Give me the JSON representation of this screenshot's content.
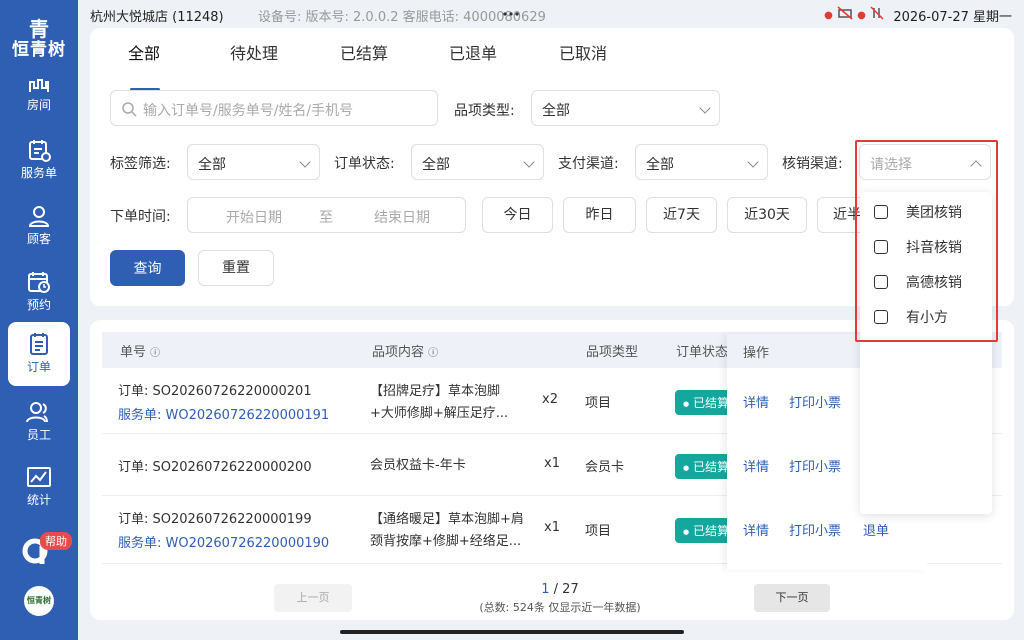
{
  "status_bar": {
    "store": "杭州大悦城店 (11248)",
    "device": "设备号: 版本号: 2.0.0.2  客服电话: 4000080629",
    "datetime": "2026-07-27 星期一"
  },
  "sidebar": {
    "logo_mark": "青",
    "brand": "恒青树",
    "items": [
      {
        "label": "房间",
        "icon": "room-icon"
      },
      {
        "label": "服务单",
        "icon": "service-order-icon"
      },
      {
        "label": "顾客",
        "icon": "customer-icon"
      },
      {
        "label": "预约",
        "icon": "calendar-icon"
      },
      {
        "label": "订单",
        "icon": "order-icon"
      },
      {
        "label": "员工",
        "icon": "staff-icon"
      },
      {
        "label": "统计",
        "icon": "stats-icon"
      }
    ],
    "help_label": "帮助",
    "bottom_logo": "恒青树"
  },
  "tabs": [
    "全部",
    "待处理",
    "已结算",
    "已退单",
    "已取消"
  ],
  "filters": {
    "search_placeholder": "输入订单号/服务单号/姓名/手机号",
    "item_type_label": "品项类型:",
    "item_type_value": "全部",
    "tag_label": "标签筛选:",
    "tag_value": "全部",
    "order_status_label": "订单状态:",
    "order_status_value": "全部",
    "pay_channel_label": "支付渠道:",
    "pay_channel_value": "全部",
    "verify_channel_label": "核销渠道:",
    "verify_channel_placeholder": "请选择",
    "order_time_label": "下单时间:",
    "start_date_placeholder": "开始日期",
    "to": "至",
    "end_date_placeholder": "结束日期",
    "quick_dates": [
      "今日",
      "昨日",
      "近7天",
      "近30天",
      "近半"
    ],
    "query_button": "查询",
    "reset_button": "重置"
  },
  "verify_options": [
    "美团核销",
    "抖音核销",
    "高德核销",
    "有小方"
  ],
  "table": {
    "headers": {
      "order_no": "单号",
      "content": "品项内容",
      "type": "品项类型",
      "status": "订单状态",
      "ops": "操作"
    },
    "rows": [
      {
        "order": "订单: SO20260726220000201",
        "service": "服务单: WO20260726220000191",
        "content1": "【招牌足疗】草本泡脚",
        "content2": "+大师修脚+解压足疗...",
        "qty": "x2",
        "type": "项目",
        "status": "已结算",
        "op_detail": "详情",
        "op_print": "打印小票",
        "op_refund": ""
      },
      {
        "order": "订单: SO20260726220000200",
        "service": "",
        "content1": "会员权益卡-年卡",
        "content2": "",
        "qty": "x1",
        "type": "会员卡",
        "status": "已结算",
        "op_detail": "详情",
        "op_print": "打印小票",
        "op_refund": ""
      },
      {
        "order": "订单: SO20260726220000199",
        "service": "服务单: WO20260726220000190",
        "content1": "【通络暖足】草本泡脚+肩",
        "content2": "颈背按摩+修脚+经络足...",
        "qty": "x1",
        "type": "项目",
        "status": "已结算",
        "op_detail": "详情",
        "op_print": "打印小票",
        "op_refund": "退单"
      }
    ]
  },
  "pagination": {
    "prev": "上一页",
    "next": "下一页",
    "current": "1",
    "total_pages": "/ 27",
    "summary": "(总数: 524条 仅显示近一年数据)"
  },
  "colors": {
    "primary": "#2f5fb3",
    "status_green": "#13a89e",
    "highlight_red": "#e53935"
  }
}
